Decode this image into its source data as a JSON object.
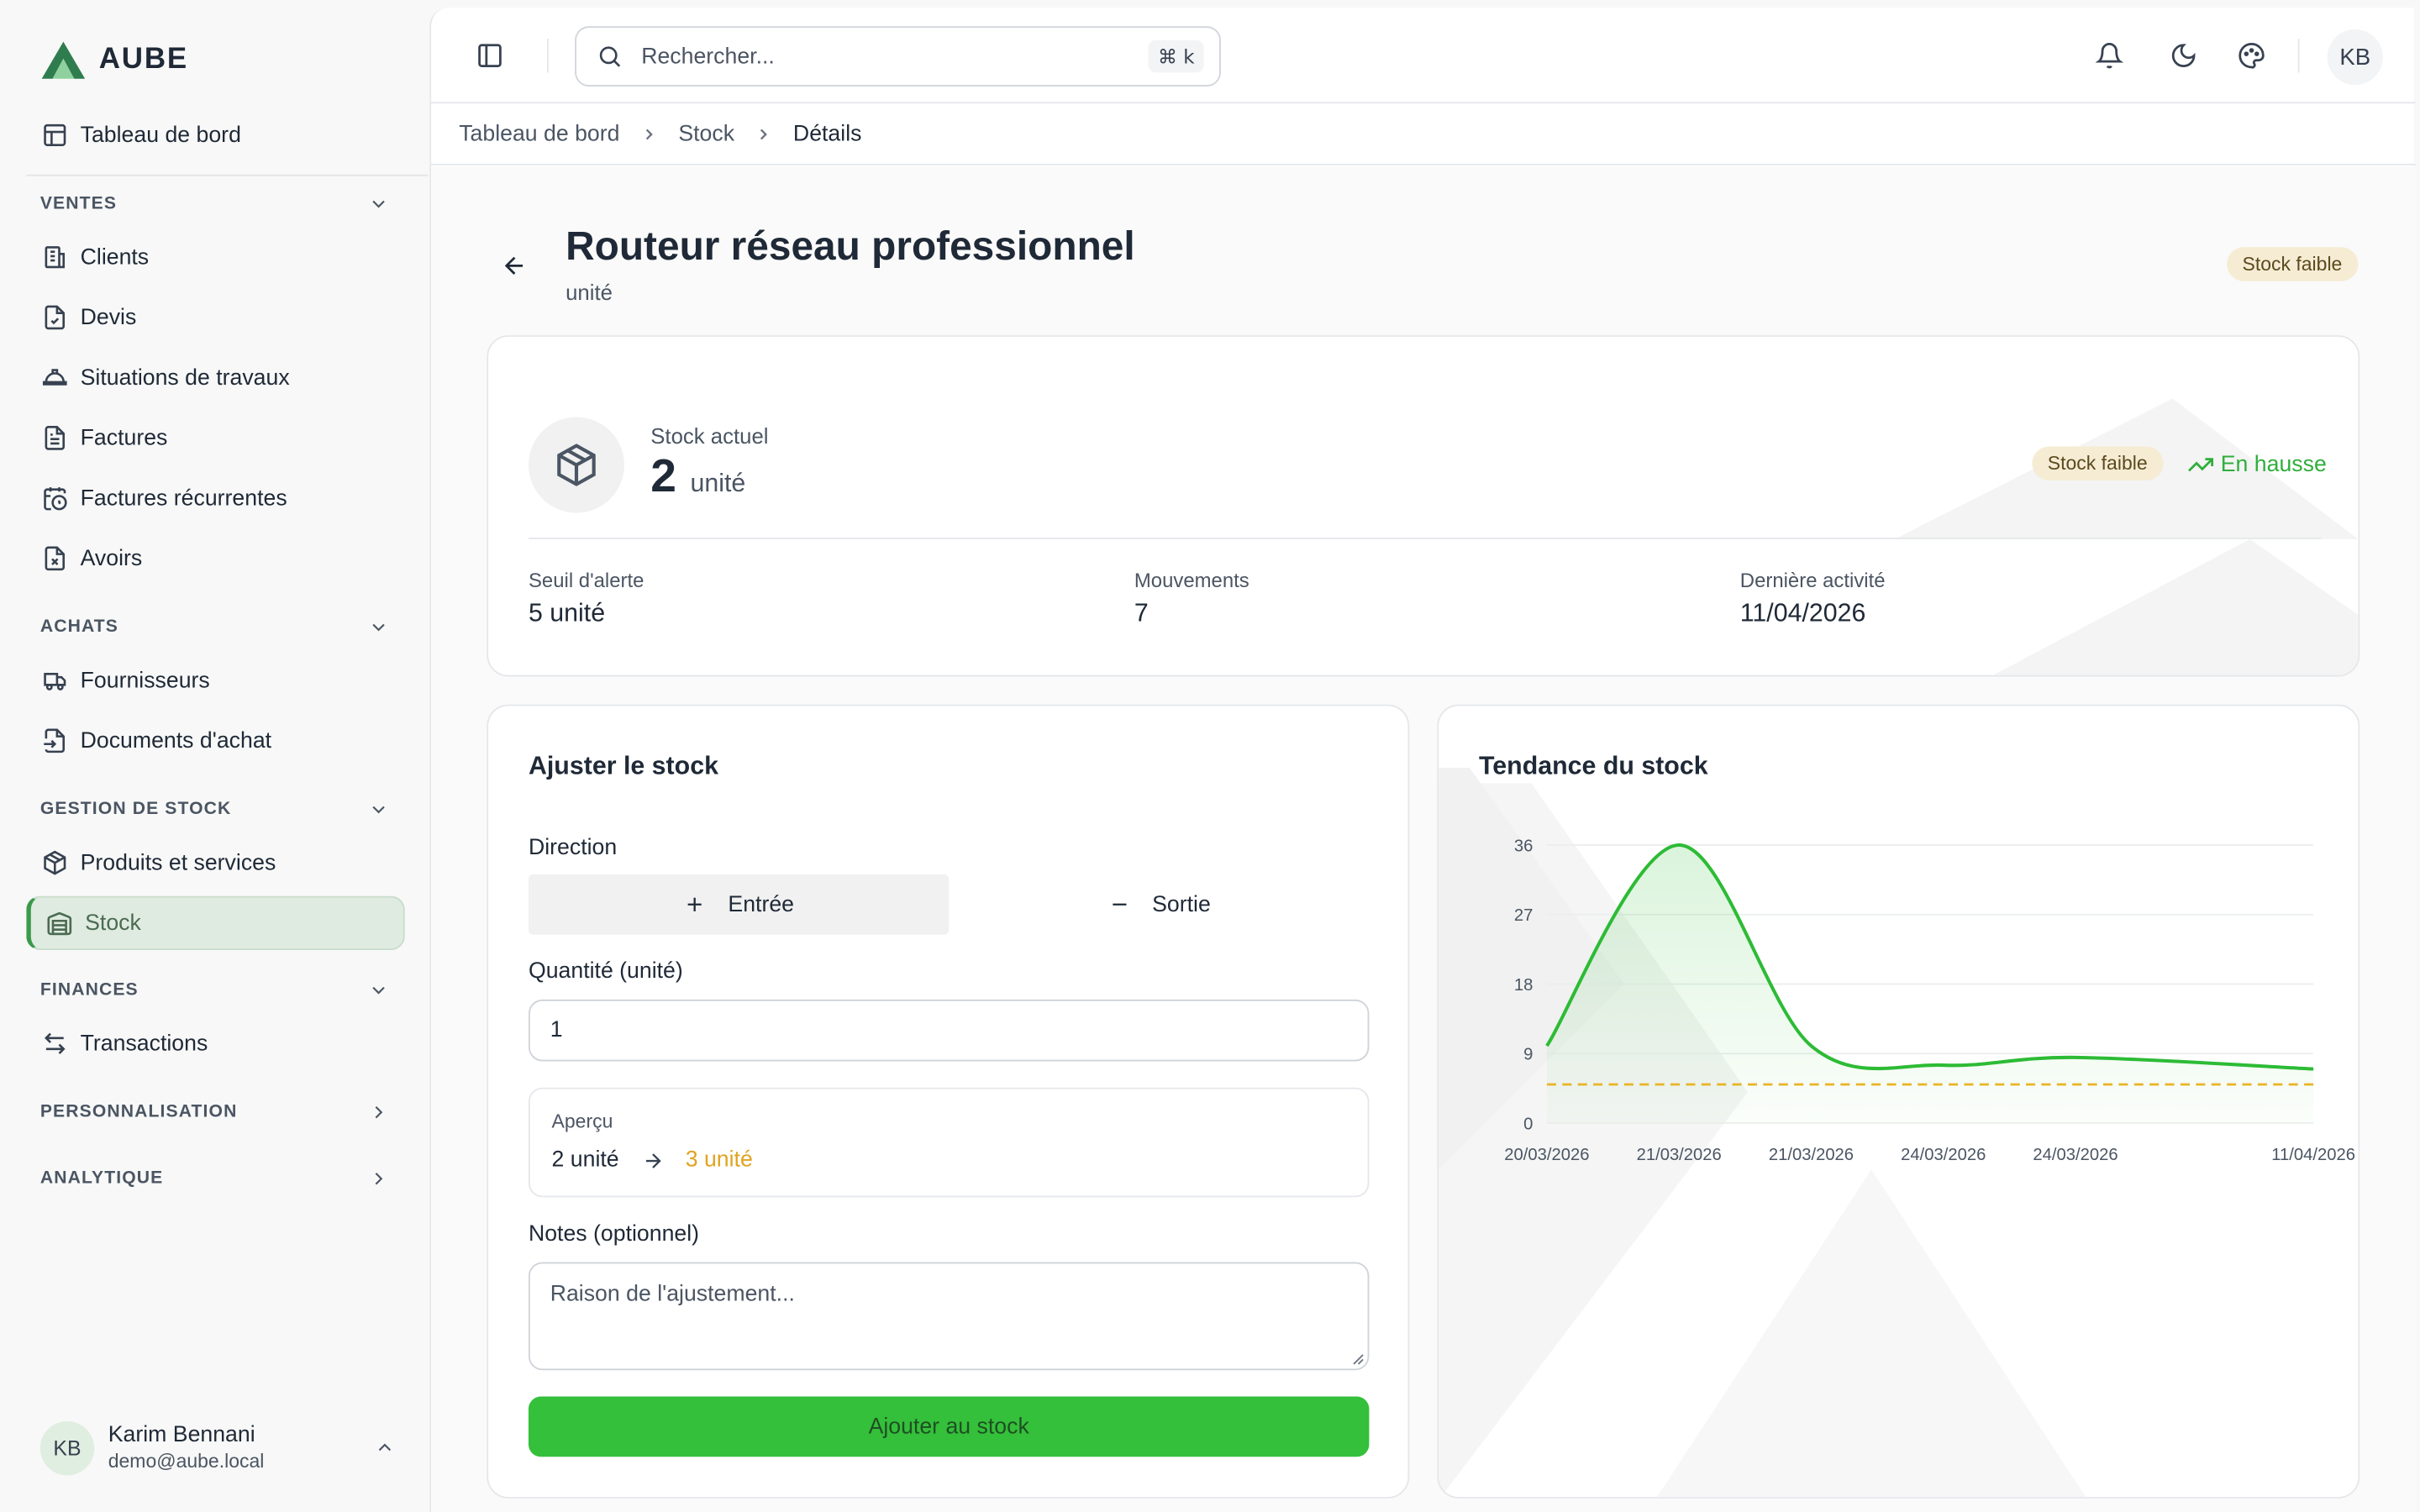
{
  "brand": {
    "name": "AUBE"
  },
  "sidebar": {
    "dashboard": "Tableau de bord",
    "sections": {
      "ventes": "VENTES",
      "achats": "ACHATS",
      "stock": "GESTION DE STOCK",
      "finances": "FINANCES",
      "perso": "PERSONNALISATION",
      "analytique": "ANALYTIQUE"
    },
    "items": {
      "clients": "Clients",
      "devis": "Devis",
      "situations": "Situations de travaux",
      "factures": "Factures",
      "factures_rec": "Factures récurrentes",
      "avoirs": "Avoirs",
      "fournisseurs": "Fournisseurs",
      "docs_achat": "Documents d'achat",
      "produits": "Produits et services",
      "stock": "Stock",
      "transactions": "Transactions"
    },
    "active": "stock",
    "user": {
      "initials": "KB",
      "name": "Karim Bennani",
      "email": "demo@aube.local"
    }
  },
  "topbar": {
    "search_placeholder": "Rechercher...",
    "shortcut": "⌘ k",
    "avatar": "KB"
  },
  "breadcrumb": [
    "Tableau de bord",
    "Stock",
    "Détails"
  ],
  "page": {
    "title": "Routeur réseau professionnel",
    "subtitle": "unité",
    "status_badge": "Stock faible"
  },
  "stock": {
    "label": "Stock actuel",
    "value": "2",
    "unit": "unité",
    "badge": "Stock faible",
    "trend": "En hausse",
    "stats": [
      {
        "label": "Seuil d'alerte",
        "value": "5 unité"
      },
      {
        "label": "Mouvements",
        "value": "7"
      },
      {
        "label": "Dernière activité",
        "value": "11/04/2026"
      }
    ]
  },
  "adjust": {
    "title": "Ajuster le stock",
    "direction_label": "Direction",
    "in_label": "Entrée",
    "out_label": "Sortie",
    "selected": "in",
    "qty_label": "Quantité (unité)",
    "qty_value": "1",
    "preview_label": "Aperçu",
    "preview_from": "2 unité",
    "preview_to": "3 unité",
    "notes_label": "Notes (optionnel)",
    "notes_placeholder": "Raison de l'ajustement...",
    "submit": "Ajouter au stock"
  },
  "colors": {
    "accent": "#34c03a",
    "line": "#2dbb35",
    "threshold": "#f0b323",
    "badge_bg": "#f6ecd4",
    "active_bg": "#dfebe0"
  },
  "chart_data": {
    "type": "line",
    "title": "Tendance du stock",
    "x": [
      "20/03/2026",
      "21/03/2026",
      "21/03/2026",
      "24/03/2026",
      "24/03/2026",
      "11/04/2026"
    ],
    "x_positions": [
      0,
      1,
      2,
      3,
      4,
      5.8
    ],
    "series": [
      {
        "values": [
          10,
          36,
          10,
          7.5,
          8.5,
          7
        ]
      }
    ],
    "yticks": [
      0,
      9,
      18,
      27,
      36
    ],
    "ylim": [
      0,
      36
    ],
    "threshold": 5,
    "grid": true,
    "legend": "none"
  }
}
